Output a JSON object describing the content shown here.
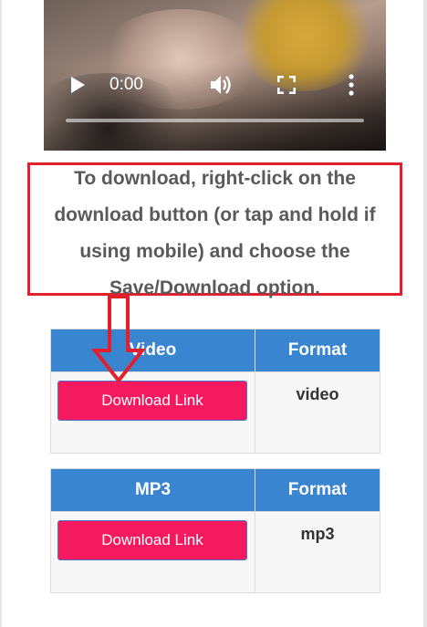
{
  "player": {
    "time": "0:00",
    "icons": [
      "play-icon",
      "volume-icon",
      "fullscreen-icon",
      "more-icon"
    ]
  },
  "instructions": {
    "text": "To download, right-click on the download button (or tap and hold if using mobile) and choose the Save/Download option.",
    "border_color": "#e0202c"
  },
  "tables": [
    {
      "header_left": "Video",
      "header_right": "Format",
      "button_label": "Download Link",
      "format": "video"
    },
    {
      "header_left": "MP3",
      "header_right": "Format",
      "button_label": "Download Link",
      "format": "mp3"
    }
  ],
  "colors": {
    "header_bg": "#3a85cf",
    "button_bg": "#f51a60",
    "arrow": "#e0202c"
  }
}
